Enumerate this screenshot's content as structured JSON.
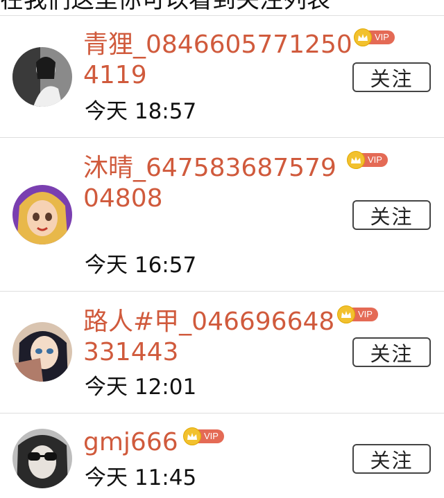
{
  "header": {
    "partial_title": "在我们这里你可以看到关注列表"
  },
  "follow_label": "关注",
  "vip_label": "VIP",
  "users": [
    {
      "name": "青狸_08466057712504119",
      "time": "今天 18:57"
    },
    {
      "name": "沐晴_64758368757904808",
      "time": "今天 16:57"
    },
    {
      "name": "路人#甲_046696648331443",
      "time": "今天 12:01"
    },
    {
      "name": "gmj666",
      "time": "今天 11:45"
    }
  ],
  "colors": {
    "name": "#d05a3c",
    "vip_tag": "#e46a55",
    "crown": "#f2c12e",
    "divider": "#dedede"
  }
}
